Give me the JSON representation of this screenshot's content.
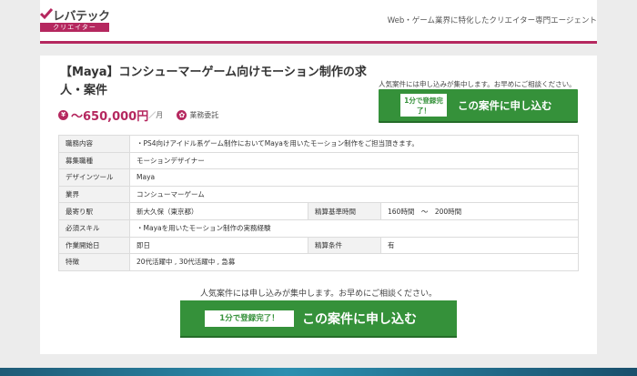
{
  "header": {
    "logo_main": "レバテック",
    "logo_sub": "クリエイター",
    "tagline": "Web・ゲーム業界に特化したクリエイター専門エージェント"
  },
  "job": {
    "title": "【Maya】コンシューマーゲーム向けモーション制作の求人・案件",
    "salary_icon": "¥",
    "salary": "～650,000円",
    "salary_unit": "／月",
    "employment_type": "業務委託"
  },
  "cta": {
    "notice": "人気案件には申し込みが集中します。お早めにご相談ください。",
    "top_badge": "1分で登録完了！",
    "bottom_badge": "1分で登録完了！",
    "label": "この案件に申し込む"
  },
  "details": {
    "r1": {
      "label": "職務内容",
      "value": "・PS4向けアイドル系ゲーム制作においてMayaを用いたモーション制作をご担当頂きます。"
    },
    "r2": {
      "label": "募集職種",
      "value": "モーションデザイナー"
    },
    "r3": {
      "label": "デザインツール",
      "value": "Maya"
    },
    "r4": {
      "label": "業界",
      "value": "コンシューマーゲーム"
    },
    "r5": {
      "label": "最寄り駅",
      "value": "新大久保（東京都）",
      "label2": "精算基準時間",
      "value2": "160時間　～　200時間"
    },
    "r6": {
      "label": "必須スキル",
      "value": "・Mayaを用いたモーション制作の実務経験"
    },
    "r7": {
      "label": "作業開始日",
      "value": "即日",
      "label2": "精算条件",
      "value2": "有"
    },
    "r8": {
      "label": "特徴",
      "value": "20代活躍中 ,  30代活躍中 ,  急募"
    }
  },
  "colors": {
    "brand": "#b5285f",
    "cta_green": "#35913a"
  }
}
